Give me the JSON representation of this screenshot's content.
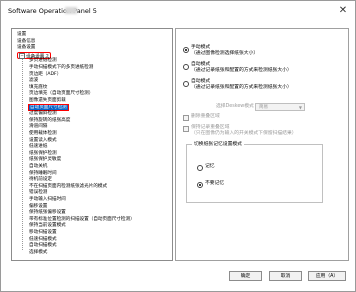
{
  "window": {
    "title": "Software Operation Panel 5"
  },
  "tree": {
    "items": [
      {
        "label": "设置",
        "level": 1
      },
      {
        "label": "设备信息",
        "level": 1
      },
      {
        "label": "设备设置",
        "level": 1
      },
      {
        "label": "设备设置 2",
        "level": 1,
        "expanded": true,
        "selected": true
      },
      {
        "label": "多页进纸检测",
        "level": 2
      },
      {
        "label": "手动扫描模式下的多页进纸检测",
        "level": 2
      },
      {
        "label": "页边距（ADF）",
        "level": 2
      },
      {
        "label": "滤波",
        "level": 2
      },
      {
        "label": "填充底纹",
        "level": 2
      },
      {
        "label": "页边填充（自动页面尺寸检测）",
        "level": 2
      },
      {
        "label": "图像遗失页面剪裁",
        "level": 2
      },
      {
        "label": "自动页面尺寸检测",
        "level": 2,
        "highlighted": true
      },
      {
        "label": "过度偏斜检测",
        "level": 2
      },
      {
        "label": "保持旋转的纸张高度",
        "level": 2
      },
      {
        "label": "滑道间隔",
        "level": 2
      },
      {
        "label": "使用载体检测",
        "level": 2
      },
      {
        "label": "设置读入模式",
        "level": 2
      },
      {
        "label": "低速进纸",
        "level": 2
      },
      {
        "label": "纸张保护检测",
        "level": 2
      },
      {
        "label": "纸张保护灵敏度",
        "level": 2
      },
      {
        "label": "自动关机",
        "level": 2
      },
      {
        "label": "保持睡眠时间",
        "level": 2
      },
      {
        "label": "待机前设定",
        "level": 2
      },
      {
        "label": "不在扫描页面内检测纸张滤光片的模式",
        "level": 2
      },
      {
        "label": "错误检测",
        "level": 2
      },
      {
        "label": "手动输入扫描时间",
        "level": 2
      },
      {
        "label": "偏移设置",
        "level": 2
      },
      {
        "label": "保持纸张偏移设置",
        "level": 2
      },
      {
        "label": "带有标准位置检测的扫描设置（自动页面尺寸检测）",
        "level": 2
      },
      {
        "label": "保持当前设置模式",
        "level": 2
      },
      {
        "label": "移动扫描设置",
        "level": 2
      },
      {
        "label": "低速扫描模式",
        "level": 2
      },
      {
        "label": "自动扫描模式",
        "level": 2
      },
      {
        "label": "选择模式",
        "level": 2
      }
    ]
  },
  "panel": {
    "radios": [
      {
        "label": "手动模式",
        "sub": "（通过图像检测选择纸张大小）",
        "checked": true
      },
      {
        "label": "自动模式",
        "sub": "（通过记录纸张和配置的方式来检测纸张大小）",
        "checked": false
      },
      {
        "label": "自动模式",
        "sub": "（通过记录纸张和配置的方式来检测纸张大小）",
        "checked": false
      }
    ],
    "select_label": "选择Deskew模式（TWAIN）",
    "select_value": "简易",
    "checkboxes": [
      {
        "label": "删除重叠区域",
        "checked": false
      },
      {
        "label": "保持记录重叠区域",
        "sub": "（只在图像仍为输入的开关模式下保留扫描结果）",
        "checked": false
      }
    ],
    "group": {
      "title": "切换纸张记忆设置模式",
      "radios": [
        {
          "label": "记忆",
          "checked": false
        },
        {
          "label": "不要记忆",
          "checked": true
        }
      ]
    }
  },
  "buttons": {
    "ok": "确定",
    "cancel": "取消",
    "apply": "应用（A）"
  },
  "icons": {
    "close": "close-icon"
  }
}
